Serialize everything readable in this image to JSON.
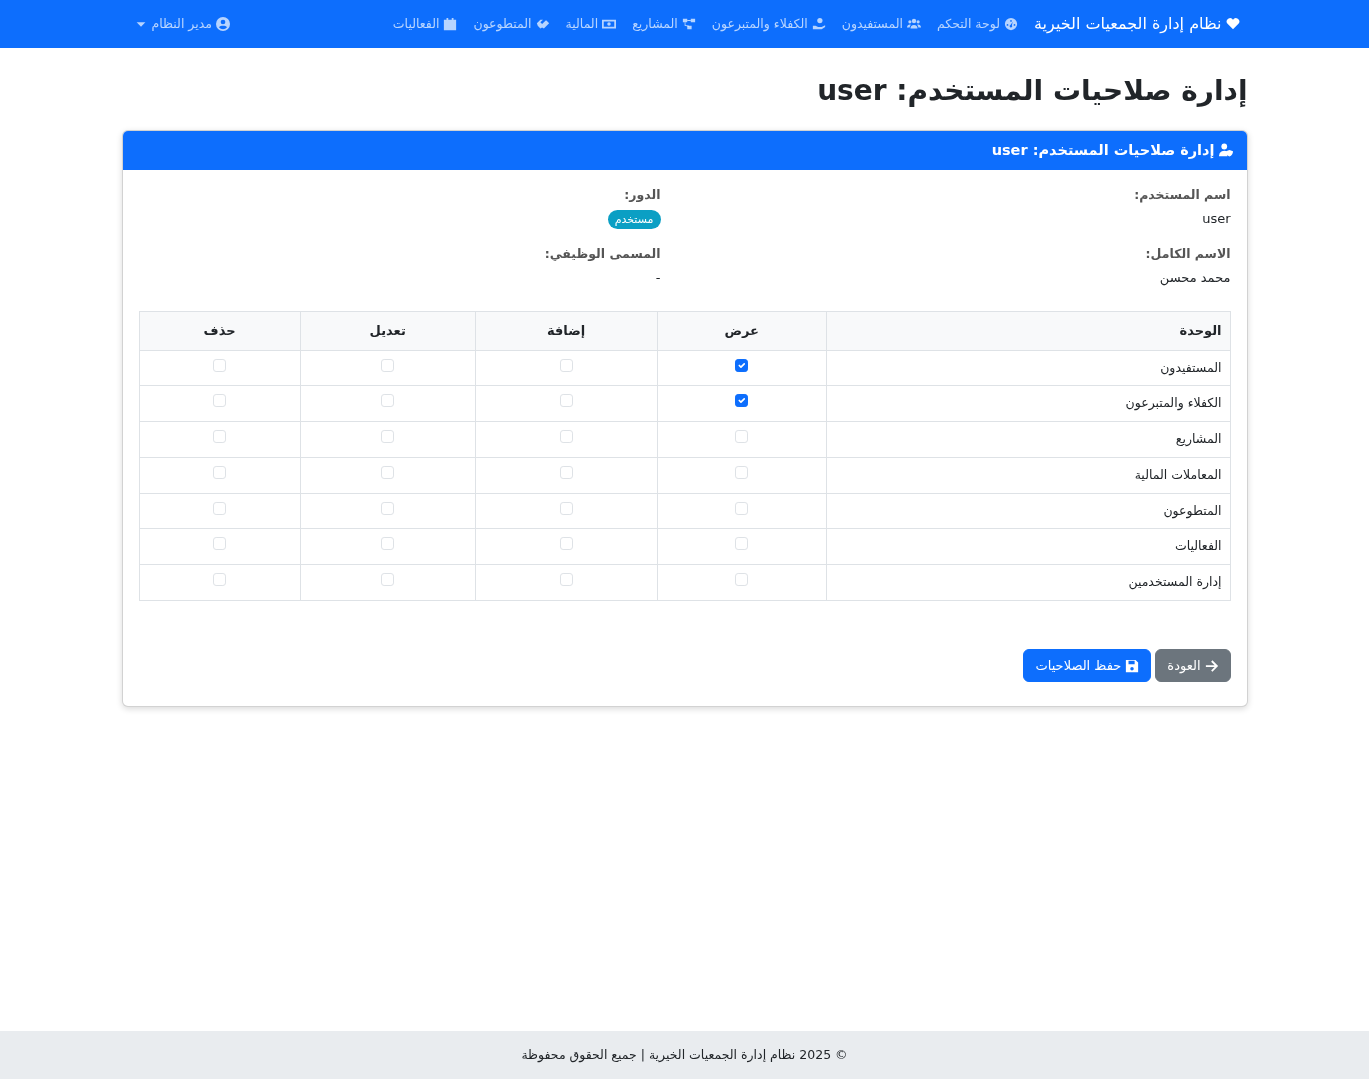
{
  "navbar": {
    "brand": "نظام إدارة الجمعيات الخيرية",
    "items": [
      {
        "label": "لوحة التحكم"
      },
      {
        "label": "المستفيدون"
      },
      {
        "label": "الكفلاء والمتبرعون"
      },
      {
        "label": "المشاريع"
      },
      {
        "label": "المالية"
      },
      {
        "label": "المتطوعون"
      },
      {
        "label": "الفعاليات"
      }
    ],
    "user_menu": "مدير النظام"
  },
  "page_title": "إدارة صلاحيات المستخدم: user",
  "card": {
    "title": "إدارة صلاحيات المستخدم: user",
    "info": [
      {
        "label": "اسم المستخدم:",
        "value": "user",
        "kind": "text"
      },
      {
        "label": "الدور:",
        "value": "مستخدم",
        "kind": "badge"
      },
      {
        "label": "الاسم الكامل:",
        "value": "محمد محسن",
        "kind": "text"
      },
      {
        "label": "المسمى الوظيفي:",
        "value": "-",
        "kind": "text"
      }
    ],
    "table": {
      "columns": [
        "الوحدة",
        "عرض",
        "إضافة",
        "تعديل",
        "حذف"
      ],
      "rows": [
        {
          "module": "المستفيدون",
          "permissions": [
            {
              "checked": true
            },
            {
              "checked": false
            },
            {
              "checked": false
            },
            {
              "checked": false
            }
          ]
        },
        {
          "module": "الكفلاء والمتبرعون",
          "permissions": [
            {
              "checked": true
            },
            {
              "checked": false
            },
            {
              "checked": false
            },
            {
              "checked": false
            }
          ]
        },
        {
          "module": "المشاريع",
          "permissions": [
            {
              "checked": false
            },
            {
              "checked": false
            },
            {
              "checked": false
            },
            {
              "checked": false
            }
          ]
        },
        {
          "module": "المعاملات المالية",
          "permissions": [
            {
              "checked": false
            },
            {
              "checked": false
            },
            {
              "checked": false
            },
            {
              "checked": false
            }
          ]
        },
        {
          "module": "المتطوعون",
          "permissions": [
            {
              "checked": false
            },
            {
              "checked": false
            },
            {
              "checked": false
            },
            {
              "checked": false
            }
          ]
        },
        {
          "module": "الفعاليات",
          "permissions": [
            {
              "checked": false
            },
            {
              "checked": false
            },
            {
              "checked": false
            },
            {
              "checked": false
            }
          ]
        },
        {
          "module": "إدارة المستخدمين",
          "permissions": [
            {
              "checked": false
            },
            {
              "checked": false
            },
            {
              "checked": false
            },
            {
              "checked": false
            }
          ]
        }
      ]
    },
    "buttons": [
      {
        "label": "العودة",
        "kind": "back"
      },
      {
        "label": "حفظ الصلاحيات",
        "kind": "save"
      }
    ]
  },
  "footer": "© 2025 نظام إدارة الجمعيات الخيرية | جميع الحقوق محفوظة"
}
